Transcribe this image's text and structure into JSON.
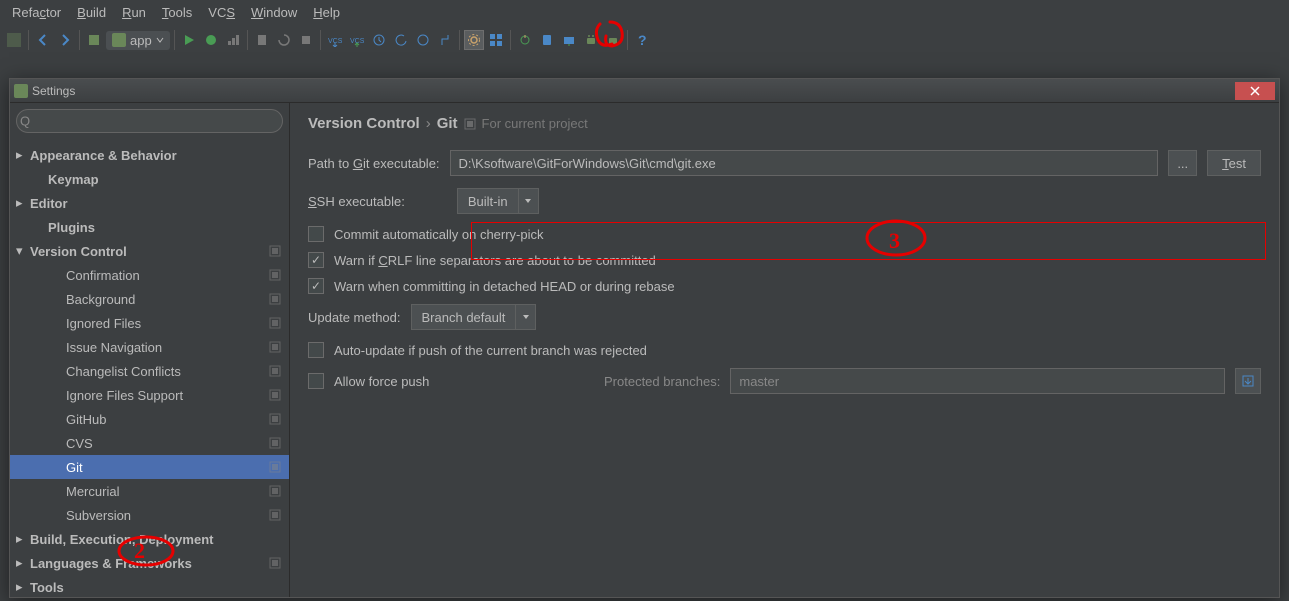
{
  "menu": {
    "items": [
      "Refactor",
      "Build",
      "Run",
      "Tools",
      "VCS",
      "Window",
      "Help"
    ],
    "underline_idx": [
      4,
      0,
      0,
      0,
      2,
      0,
      0
    ]
  },
  "toolbar": {
    "app_label": "app"
  },
  "dialog": {
    "title": "Settings"
  },
  "sidebar": {
    "search_placeholder": "",
    "search_glyph": "Q",
    "tree": [
      {
        "label": "Appearance & Behavior",
        "indent": 0,
        "bold": true,
        "arrow": "right",
        "badge": false
      },
      {
        "label": "Keymap",
        "indent": 1,
        "bold": true,
        "arrow": "",
        "badge": false
      },
      {
        "label": "Editor",
        "indent": 0,
        "bold": true,
        "arrow": "right",
        "badge": false
      },
      {
        "label": "Plugins",
        "indent": 1,
        "bold": true,
        "arrow": "",
        "badge": false
      },
      {
        "label": "Version Control",
        "indent": 0,
        "bold": true,
        "arrow": "down",
        "badge": true
      },
      {
        "label": "Confirmation",
        "indent": 2,
        "bold": false,
        "arrow": "",
        "badge": true
      },
      {
        "label": "Background",
        "indent": 2,
        "bold": false,
        "arrow": "",
        "badge": true
      },
      {
        "label": "Ignored Files",
        "indent": 2,
        "bold": false,
        "arrow": "",
        "badge": true
      },
      {
        "label": "Issue Navigation",
        "indent": 2,
        "bold": false,
        "arrow": "",
        "badge": true
      },
      {
        "label": "Changelist Conflicts",
        "indent": 2,
        "bold": false,
        "arrow": "",
        "badge": true
      },
      {
        "label": "Ignore Files Support",
        "indent": 2,
        "bold": false,
        "arrow": "",
        "badge": true
      },
      {
        "label": "GitHub",
        "indent": 2,
        "bold": false,
        "arrow": "",
        "badge": true
      },
      {
        "label": "CVS",
        "indent": 2,
        "bold": false,
        "arrow": "",
        "badge": true
      },
      {
        "label": "Git",
        "indent": 2,
        "bold": false,
        "arrow": "",
        "badge": true,
        "selected": true
      },
      {
        "label": "Mercurial",
        "indent": 2,
        "bold": false,
        "arrow": "",
        "badge": true
      },
      {
        "label": "Subversion",
        "indent": 2,
        "bold": false,
        "arrow": "",
        "badge": true
      },
      {
        "label": "Build, Execution, Deployment",
        "indent": 0,
        "bold": true,
        "arrow": "right",
        "badge": false
      },
      {
        "label": "Languages & Frameworks",
        "indent": 0,
        "bold": true,
        "arrow": "right",
        "badge": true
      },
      {
        "label": "Tools",
        "indent": 0,
        "bold": true,
        "arrow": "right",
        "badge": false
      }
    ]
  },
  "content": {
    "breadcrumb_root": "Version Control",
    "breadcrumb_leaf": "Git",
    "breadcrumb_hint": "For current project",
    "path_label_pre": "Path to ",
    "path_label_u": "G",
    "path_label_post": "it executable:",
    "path_value": "D:\\Ksoftware\\GitForWindows\\Git\\cmd\\git.exe",
    "browse_label": "...",
    "test_u": "T",
    "test_post": "est",
    "ssh_u": "S",
    "ssh_post": "SH executable:",
    "ssh_value": "Built-in",
    "cb_cherry": "Commit automatically on cherry-pick",
    "cb_crlf_pre": "Warn if ",
    "cb_crlf_u": "C",
    "cb_crlf_post": "RLF line separators are about to be committed",
    "cb_detached": "Warn when committing in detached HEAD or during rebase",
    "update_label": "Update method:",
    "update_value": "Branch default",
    "cb_autoupdate": "Auto-update if push of the current branch was rejected",
    "cb_force": "Allow force push",
    "protected_label": "Protected branches:",
    "protected_value": "master"
  },
  "annotations": {
    "num2": "2",
    "num3": "3"
  }
}
